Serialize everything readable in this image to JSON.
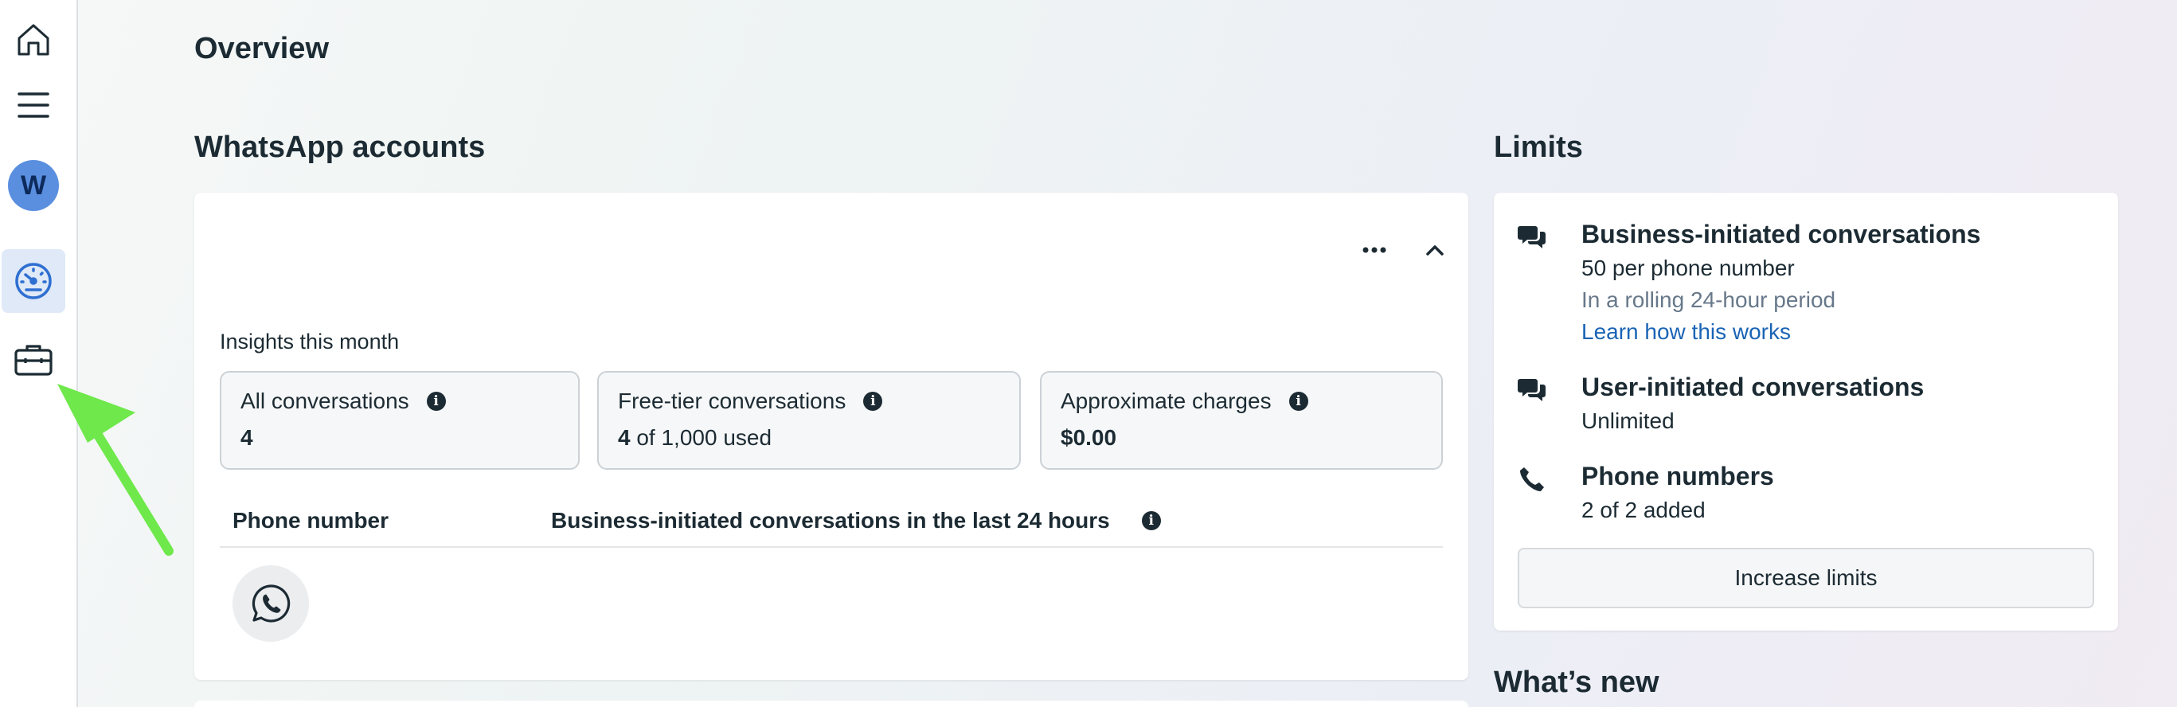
{
  "page": {
    "title": "Overview"
  },
  "sidebar": {
    "avatar_letter": "W",
    "items": [
      {
        "name": "home-icon"
      },
      {
        "name": "menu-icon"
      },
      {
        "name": "avatar"
      },
      {
        "name": "dashboard-icon",
        "active": true
      },
      {
        "name": "briefcase-icon"
      }
    ]
  },
  "whatsapp_accounts": {
    "title": "WhatsApp accounts",
    "insights_label": "Insights this month",
    "stats": [
      {
        "label": "All conversations",
        "value_bold": "4",
        "value_rest": ""
      },
      {
        "label": "Free-tier conversations",
        "value_bold": "4",
        "value_rest": " of 1,000 used"
      },
      {
        "label": "Approximate charges",
        "value_bold": "$0.00",
        "value_rest": ""
      }
    ],
    "table": {
      "columns": [
        "Phone number",
        "Business-initiated conversations in the last 24 hours"
      ]
    }
  },
  "limits": {
    "title": "Limits",
    "items": [
      {
        "title": "Business-initiated conversations",
        "lines": [
          "50 per phone number",
          "In a rolling 24-hour period",
          "Learn how this works"
        ]
      },
      {
        "title": "User-initiated conversations",
        "lines": [
          "Unlimited"
        ]
      },
      {
        "title": "Phone numbers",
        "lines": [
          "2 of 2 added"
        ]
      }
    ],
    "button_label": "Increase limits"
  },
  "whats_new": {
    "title": "What’s new"
  },
  "colors": {
    "accent": "#1a64b5",
    "annotation": "#6ee84a",
    "avatar": "#5a8fe0"
  }
}
